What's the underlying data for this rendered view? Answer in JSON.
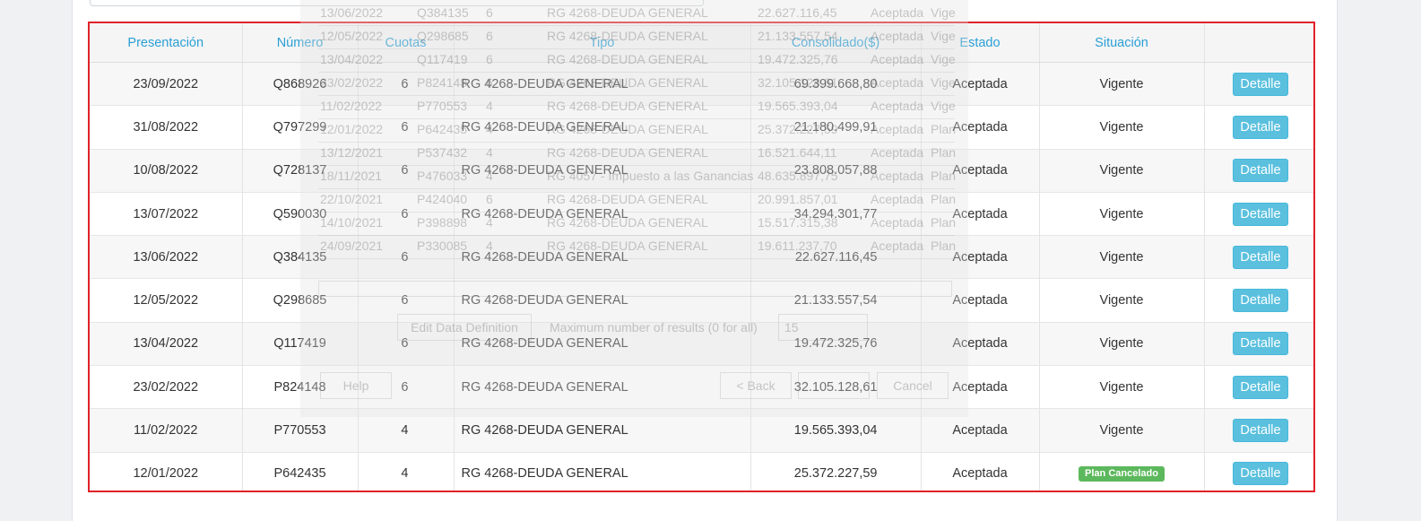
{
  "table": {
    "headers": {
      "presentacion": "Presentación",
      "numero": "Número",
      "cuotas": "Cuotas",
      "tipo": "Tipo",
      "consolidado": "Consolidado($)",
      "estado": "Estado",
      "situacion": "Situación",
      "acciones": ""
    },
    "button_label": "Detalle",
    "rows": [
      {
        "presentacion": "23/09/2022",
        "numero": "Q868926",
        "cuotas": "6",
        "tipo": "RG 4268-DEUDA GENERAL",
        "consolidado": "69.399.668,80",
        "estado": "Aceptada",
        "situacion": "Vigente",
        "badge": ""
      },
      {
        "presentacion": "31/08/2022",
        "numero": "Q797299",
        "cuotas": "6",
        "tipo": "RG 4268-DEUDA GENERAL",
        "consolidado": "21.180.499,91",
        "estado": "Aceptada",
        "situacion": "Vigente",
        "badge": ""
      },
      {
        "presentacion": "10/08/2022",
        "numero": "Q728137",
        "cuotas": "6",
        "tipo": "RG 4268-DEUDA GENERAL",
        "consolidado": "23.808.057,88",
        "estado": "Aceptada",
        "situacion": "Vigente",
        "badge": ""
      },
      {
        "presentacion": "13/07/2022",
        "numero": "Q590030",
        "cuotas": "6",
        "tipo": "RG 4268-DEUDA GENERAL",
        "consolidado": "34.294.301,77",
        "estado": "Aceptada",
        "situacion": "Vigente",
        "badge": ""
      },
      {
        "presentacion": "13/06/2022",
        "numero": "Q384135",
        "cuotas": "6",
        "tipo": "RG 4268-DEUDA GENERAL",
        "consolidado": "22.627.116,45",
        "estado": "Aceptada",
        "situacion": "Vigente",
        "badge": ""
      },
      {
        "presentacion": "12/05/2022",
        "numero": "Q298685",
        "cuotas": "6",
        "tipo": "RG 4268-DEUDA GENERAL",
        "consolidado": "21.133.557,54",
        "estado": "Aceptada",
        "situacion": "Vigente",
        "badge": ""
      },
      {
        "presentacion": "13/04/2022",
        "numero": "Q117419",
        "cuotas": "6",
        "tipo": "RG 4268-DEUDA GENERAL",
        "consolidado": "19.472.325,76",
        "estado": "Aceptada",
        "situacion": "Vigente",
        "badge": ""
      },
      {
        "presentacion": "23/02/2022",
        "numero": "P824148",
        "cuotas": "6",
        "tipo": "RG 4268-DEUDA GENERAL",
        "consolidado": "32.105.128,61",
        "estado": "Aceptada",
        "situacion": "Vigente",
        "badge": ""
      },
      {
        "presentacion": "11/02/2022",
        "numero": "P770553",
        "cuotas": "4",
        "tipo": "RG 4268-DEUDA GENERAL",
        "consolidado": "19.565.393,04",
        "estado": "Aceptada",
        "situacion": "Vigente",
        "badge": ""
      },
      {
        "presentacion": "12/01/2022",
        "numero": "P642435",
        "cuotas": "4",
        "tipo": "RG 4268-DEUDA GENERAL",
        "consolidado": "25.372.227,59",
        "estado": "Aceptada",
        "situacion": "",
        "badge": "Plan Cancelado"
      }
    ]
  },
  "ghost_dialog": {
    "rows": [
      [
        "13/06/2022",
        "Q384135",
        "6",
        "RG 4268-DEUDA GENERAL",
        "22.627.116,45",
        "Aceptada",
        "Vige"
      ],
      [
        "12/05/2022",
        "Q298685",
        "6",
        "RG 4268-DEUDA GENERAL",
        "21.133.557,54",
        "Aceptada",
        "Vige"
      ],
      [
        "13/04/2022",
        "Q117419",
        "6",
        "RG 4268-DEUDA GENERAL",
        "19.472.325,76",
        "Aceptada",
        "Vige"
      ],
      [
        "23/02/2022",
        "P824148",
        "6",
        "RG 4268-DEUDA GENERAL",
        "32.105.128,61",
        "Aceptada",
        "Vige"
      ],
      [
        "11/02/2022",
        "P770553",
        "4",
        "RG 4268-DEUDA GENERAL",
        "19.565.393,04",
        "Aceptada",
        "Vige"
      ],
      [
        "12/01/2022",
        "P642435",
        "4",
        "RG 4268-DEUDA GENERAL",
        "25.372.227,59",
        "Aceptada",
        "Plan"
      ],
      [
        "13/12/2021",
        "P537432",
        "4",
        "RG 4268-DEUDA GENERAL",
        "16.521.644,11",
        "Aceptada",
        "Plan"
      ],
      [
        "18/11/2021",
        "P476033",
        "4",
        "RG 4057 - Impuesto a las Ganancias",
        "48.635.897,75",
        "Aceptada",
        "Plan"
      ],
      [
        "22/10/2021",
        "P424040",
        "6",
        "RG 4268-DEUDA GENERAL",
        "20.991.857,01",
        "Aceptada",
        "Plan"
      ],
      [
        "14/10/2021",
        "P398898",
        "4",
        "RG 4268-DEUDA GENERAL",
        "15.517.315,38",
        "Aceptada",
        "Plan"
      ],
      [
        "24/09/2021",
        "P330085",
        "4",
        "RG 4268-DEUDA GENERAL",
        "19.611.237,70",
        "Aceptada",
        "Plan"
      ]
    ],
    "edit_label": "Edit Data Definition",
    "max_label": "Maximum number of results (0 for all)",
    "max_value": "15",
    "help_label": "Help",
    "back_label": "< Back",
    "cancel_label": "Cancel"
  }
}
